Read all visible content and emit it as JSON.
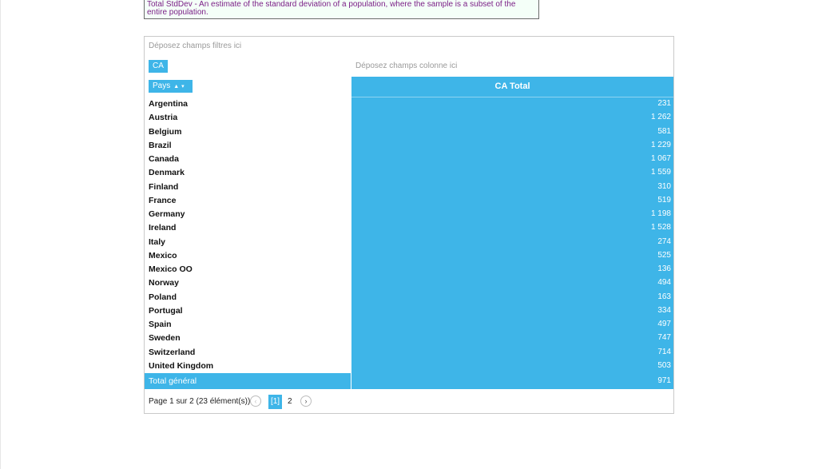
{
  "tooltip": {
    "text": "Total StdDev - An estimate of the standard deviation of a population, where the sample is a subset of the entire population."
  },
  "pivot": {
    "filter_zone": "Déposez champs filtres ici",
    "data_field": "CA",
    "column_zone": "Déposez champs colonne ici",
    "row_field": "Pays",
    "column_header": "CA Total",
    "rows": [
      {
        "name": "Argentina",
        "value": "231"
      },
      {
        "name": "Austria",
        "value": "1 262"
      },
      {
        "name": "Belgium",
        "value": "581"
      },
      {
        "name": "Brazil",
        "value": "1 229"
      },
      {
        "name": "Canada",
        "value": "1 067"
      },
      {
        "name": "Denmark",
        "value": "1 559"
      },
      {
        "name": "Finland",
        "value": "310"
      },
      {
        "name": "France",
        "value": "519"
      },
      {
        "name": "Germany",
        "value": "1 198"
      },
      {
        "name": "Ireland",
        "value": "1 528"
      },
      {
        "name": "Italy",
        "value": "274"
      },
      {
        "name": "Mexico",
        "value": "525"
      },
      {
        "name": "Mexico OO",
        "value": "136"
      },
      {
        "name": "Norway",
        "value": "494"
      },
      {
        "name": "Poland",
        "value": "163"
      },
      {
        "name": "Portugal",
        "value": "334"
      },
      {
        "name": "Spain",
        "value": "497"
      },
      {
        "name": "Sweden",
        "value": "747"
      },
      {
        "name": "Switzerland",
        "value": "714"
      },
      {
        "name": "United Kingdom",
        "value": "503"
      }
    ],
    "total_label": "Total général",
    "total_value": "971"
  },
  "pager": {
    "summary": "Page 1 sur 2 (23 élément(s))",
    "current": "[1]",
    "next_page": "2"
  },
  "colors": {
    "accent": "#3eb5e8",
    "tooltip_text": "#7b1f87"
  }
}
